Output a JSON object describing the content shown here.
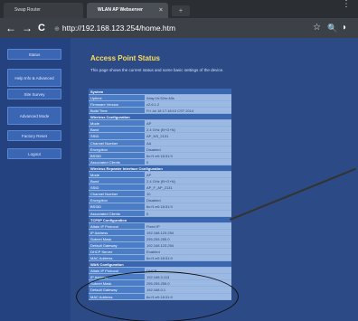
{
  "browser": {
    "tabs": [
      {
        "label": "Swap Router"
      },
      {
        "label": "WLAN AP Webserver",
        "close": "×"
      }
    ],
    "new_tab": "+",
    "back": "←",
    "forward": "→",
    "reload": "C",
    "url_icon": "⊕",
    "url": "http://192.168.123.254/home.htm",
    "star_icon": "☆",
    "search_icon": "🔍",
    "menu_icon": "⋮",
    "extra_icon": "◗"
  },
  "sidebar": {
    "items": [
      {
        "label": "Status"
      },
      {
        "label": "Help Info & Advanced"
      },
      {
        "label": "Site Survey"
      },
      {
        "label": "Advanced Mode"
      },
      {
        "label": "Factory Reset"
      },
      {
        "label": "Logout"
      }
    ]
  },
  "main": {
    "title": "Access Point Status",
    "description": "This page shows the current status and some basic settings of the device."
  },
  "status_table": [
    {
      "type": "header",
      "label": "System"
    },
    {
      "k": "Uptime",
      "v": "0day:1h:52m:48s"
    },
    {
      "k": "Firmware Version",
      "v": "v2.6.1.2"
    },
    {
      "k": "Build Time",
      "v": "Fri Jul 18 17:18:10 CST 2014"
    },
    {
      "type": "header",
      "label": "Wireless Configuration"
    },
    {
      "k": "Mode",
      "v": "AP"
    },
    {
      "k": "Band",
      "v": "2.4 GHz (B+G+N)"
    },
    {
      "k": "SSID",
      "v": "AP_NS_2131"
    },
    {
      "k": "Channel Number",
      "v": "AA"
    },
    {
      "k": "Encryption",
      "v": "Disabled"
    },
    {
      "k": "BSSID",
      "v": "6c:f1:e0:18:31:9"
    },
    {
      "k": "Associated Clients",
      "v": "0"
    },
    {
      "type": "header",
      "label": "Wireless Repeater Interface Configuration"
    },
    {
      "k": "Mode",
      "v": "AP"
    },
    {
      "k": "Band",
      "v": "2.4 GHz (B+G+N)"
    },
    {
      "k": "SSID",
      "v": "AP_F_AP_2131"
    },
    {
      "k": "Channel Number",
      "v": "10"
    },
    {
      "k": "Encryption",
      "v": "Disabled"
    },
    {
      "k": "BSSID",
      "v": "6c:f1:e0:18:31:9"
    },
    {
      "k": "Associated Clients",
      "v": "0"
    },
    {
      "type": "header",
      "label": "TCP/IP Configuration"
    },
    {
      "k": "Attain IP Protocol",
      "v": "Fixed IP"
    },
    {
      "k": "IP Address",
      "v": "192.168.123.254"
    },
    {
      "k": "Subnet Mask",
      "v": "255.255.255.0"
    },
    {
      "k": "Default Gateway",
      "v": "192.168.123.254"
    },
    {
      "k": "DHCP Server",
      "v": "Enabled"
    },
    {
      "k": "MAC Address",
      "v": "6c:f1:e0:18:31:9"
    },
    {
      "type": "header",
      "label": "WAN Configuration"
    },
    {
      "k": "Attain IP Protocol",
      "v": "DHCP"
    },
    {
      "k": "IP Address",
      "v": "192.168.0.113"
    },
    {
      "k": "Subnet Mask",
      "v": "255.255.255.0"
    },
    {
      "k": "Default Gateway",
      "v": "192.168.0.1"
    },
    {
      "k": "MAC Address",
      "v": "6c:f1:e0:18:31:9"
    }
  ]
}
